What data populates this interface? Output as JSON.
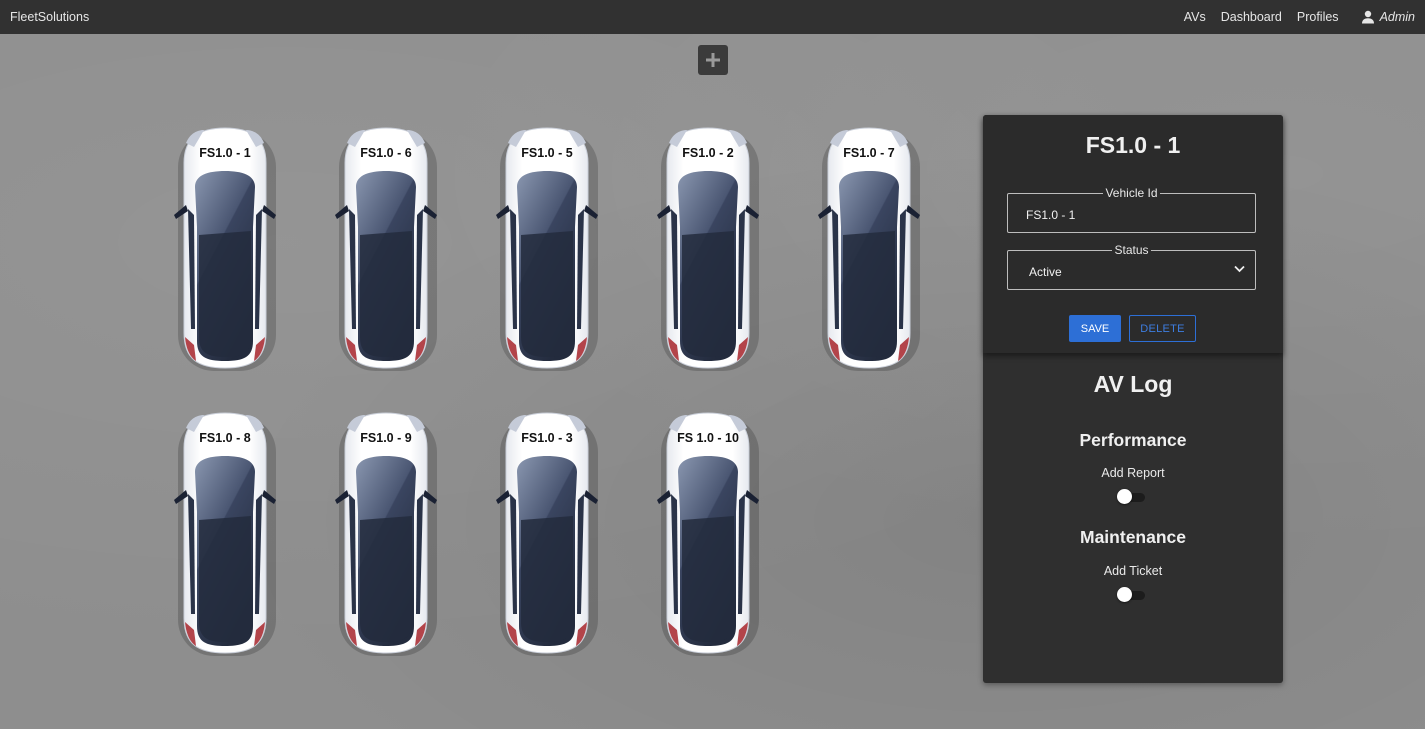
{
  "navbar": {
    "brand": "FleetSolutions",
    "links": [
      "AVs",
      "Dashboard",
      "Profiles"
    ],
    "user": "Admin",
    "user_icon": "user-icon"
  },
  "toolbar": {
    "add_icon": "plus-icon"
  },
  "vehicles": [
    "FS1.0 - 1",
    "FS1.0 - 6",
    "FS1.0 - 5",
    "FS1.0 - 2",
    "FS1.0 - 7",
    "FS1.0 - 8",
    "FS1.0 - 9",
    "FS1.0 - 3",
    "FS 1.0 - 10"
  ],
  "details": {
    "title": "FS1.0 - 1",
    "vehicle_id_label": "Vehicle Id",
    "vehicle_id_value": "FS1.0 - 1",
    "status_label": "Status",
    "status_value": "Active",
    "save_label": "SAVE",
    "delete_label": "DELETE"
  },
  "log": {
    "title": "AV Log",
    "performance_title": "Performance",
    "add_report_label": "Add Report",
    "add_report_on": false,
    "maintenance_title": "Maintenance",
    "add_ticket_label": "Add Ticket",
    "add_ticket_on": false
  },
  "colors": {
    "accent": "#2d6fd6",
    "navbar": "#313131",
    "panel": "#2f2f2f",
    "floor": "#8e8e8e"
  }
}
